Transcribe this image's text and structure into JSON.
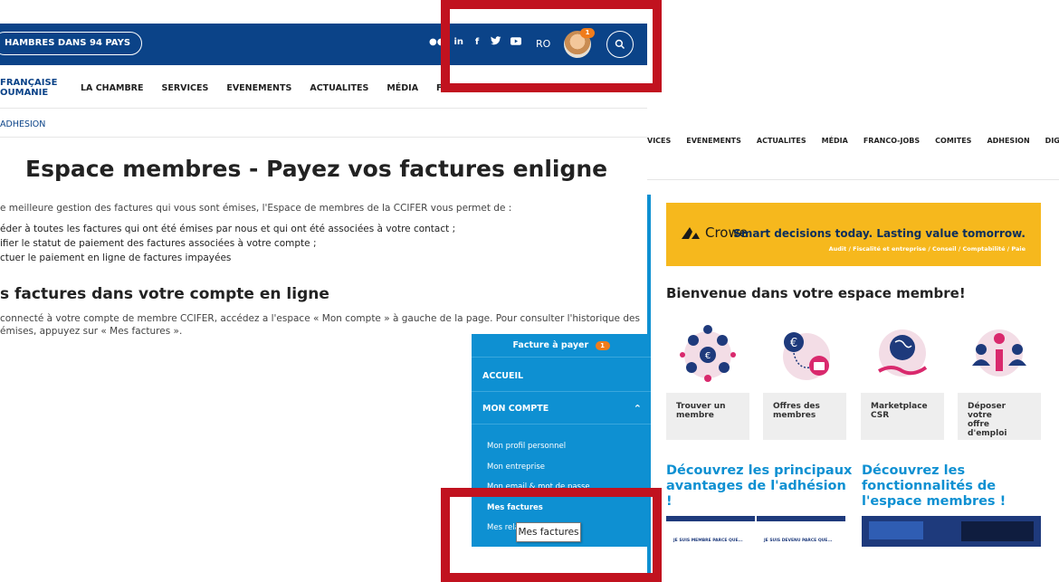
{
  "left_page": {
    "topbar": {
      "chambers_pill": "HAMBRES DANS 94 PAYS",
      "social_icons": [
        "flickr-icon",
        "linkedin-icon",
        "facebook-icon",
        "twitter-icon",
        "youtube-icon"
      ],
      "social_glyphs": {
        "flickr": "●●",
        "linkedin": "in",
        "facebook": "f",
        "twitter": "🐦",
        "youtube": "▶"
      },
      "language": "RO",
      "notification_count": "1",
      "colors": {
        "bar": "#0b4388",
        "badge": "#f07c1b"
      }
    },
    "logo": {
      "line1": "FRANÇAISE",
      "line2": "OUMANIE"
    },
    "nav": [
      "LA CHAMBRE",
      "SERVICES",
      "EVENEMENTS",
      "ACTUALITES",
      "MÉDIA",
      "FRANCO-JOBS"
    ],
    "breadcrumb": "ADHESION",
    "title": "Espace membres - Payez vos factures enligne",
    "intro": "e meilleure gestion des factures qui vous sont émises, l'Espace de membres de la CCIFER vous permet de :",
    "bullets": [
      "éder à toutes les factures qui ont été émises par nous et qui ont été associées à votre contact ;",
      "ifier le statut de paiement des factures associées à votre compte ;",
      "ctuer le paiement en ligne de factures impayées"
    ],
    "subtitle": "s factures dans votre compte en ligne",
    "body_line1": "connecté à votre compte de membre CCIFER, accédez a l'espace « Mon compte » à gauche de la page. Pour consulter l'historique des",
    "body_line2": "émises, appuyez sur « Mes factures »."
  },
  "member_menu": {
    "header": "Facture à payer",
    "badge": "1",
    "accueil": "ACCUEIL",
    "mon_compte": "MON COMPTE",
    "chevron": "⌃",
    "subitems": [
      "Mon profil personnel",
      "Mon entreprise",
      "Mon email & mot de passe",
      "Mes factures",
      "Mes rela"
    ],
    "tooltip": "Mes factures",
    "color": "#0e90d2"
  },
  "right_page": {
    "nav": [
      "VICES",
      "EVENEMENTS",
      "ACTUALITES",
      "MÉDIA",
      "FRANCO-JOBS",
      "COMITES",
      "ADHESION",
      "DIGITON"
    ],
    "banner": {
      "brand": "Crowe",
      "tagline": "Smart decisions today. Lasting value tomorrow.",
      "sub": "Audit / Fiscalité et entreprise / Conseil / Comptabilité / Paie",
      "color": "#f6b81d"
    },
    "welcome": "Bienvenue dans votre espace membre!",
    "features": [
      {
        "line1": "Trouver un",
        "line2": "membre",
        "icon": "network-icon"
      },
      {
        "line1": "Offres des",
        "line2": "membres",
        "icon": "euro-briefcase-icon"
      },
      {
        "line1": "Marketplace",
        "line2": "CSR",
        "icon": "globe-hand-icon"
      },
      {
        "line1": "Déposer votre",
        "line2": "offre d'emploi",
        "icon": "people-hand-icon"
      }
    ],
    "promo_left": [
      "Découvrez les principaux",
      "avantages de l'adhésion",
      "!"
    ],
    "promo_right": [
      "Découvrez les",
      "fonctionnalités de",
      "l'espace membres !"
    ],
    "thumbs": [
      "JE SUIS MEMBRE PARCE QUE...",
      "JE SUIS DEVENU PARCE QUE..."
    ]
  },
  "annotation_color": "#c1121f"
}
